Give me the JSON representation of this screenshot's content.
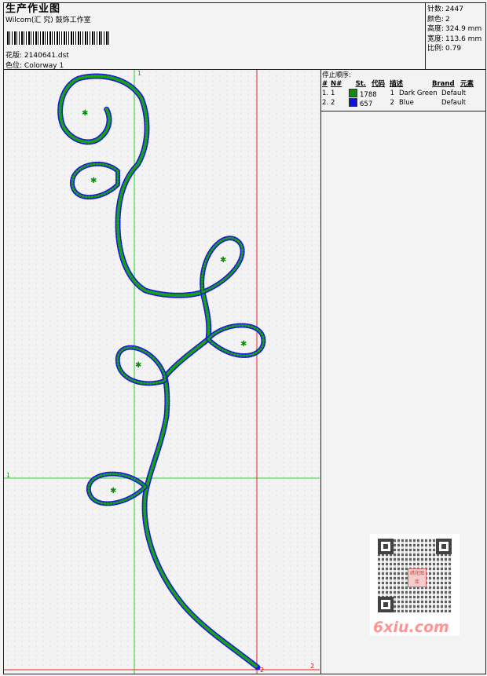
{
  "header": {
    "title": "生产作业图",
    "studio": "Wilcom(汇 究) 鼓饰工作室",
    "design_label": "花版:",
    "design_value": "2140641.dst",
    "color_label": "色位:",
    "color_value": "Colorway 1"
  },
  "stats": [
    {
      "label": "针数:",
      "value": "2447"
    },
    {
      "label": "颜色:",
      "value": "2"
    },
    {
      "label": "高度:",
      "value": "324.9 mm"
    },
    {
      "label": "宽度:",
      "value": "113.6 mm"
    },
    {
      "label": "比例:",
      "value": "0.79"
    }
  ],
  "stop_table": {
    "caption": "停止顺序:",
    "headers": [
      "#",
      "N#",
      "St.",
      "代码",
      "描述",
      "Brand",
      "元素"
    ],
    "rows": [
      {
        "idx": "1.",
        "n": "1",
        "color": "#108a10",
        "st": "1788",
        "code": "1",
        "desc": "Dark Green",
        "brand": "Default"
      },
      {
        "idx": "2.",
        "n": "2",
        "color": "#1010e0",
        "st": "657",
        "code": "2",
        "desc": "Blue",
        "brand": "Default"
      }
    ]
  },
  "guides": {
    "green_top": "1",
    "green_left": "1",
    "red_bottom_a": "2",
    "red_bottom_b": "2"
  },
  "watermark": {
    "brand": "6xiu.com",
    "logo": "绣花图库"
  }
}
